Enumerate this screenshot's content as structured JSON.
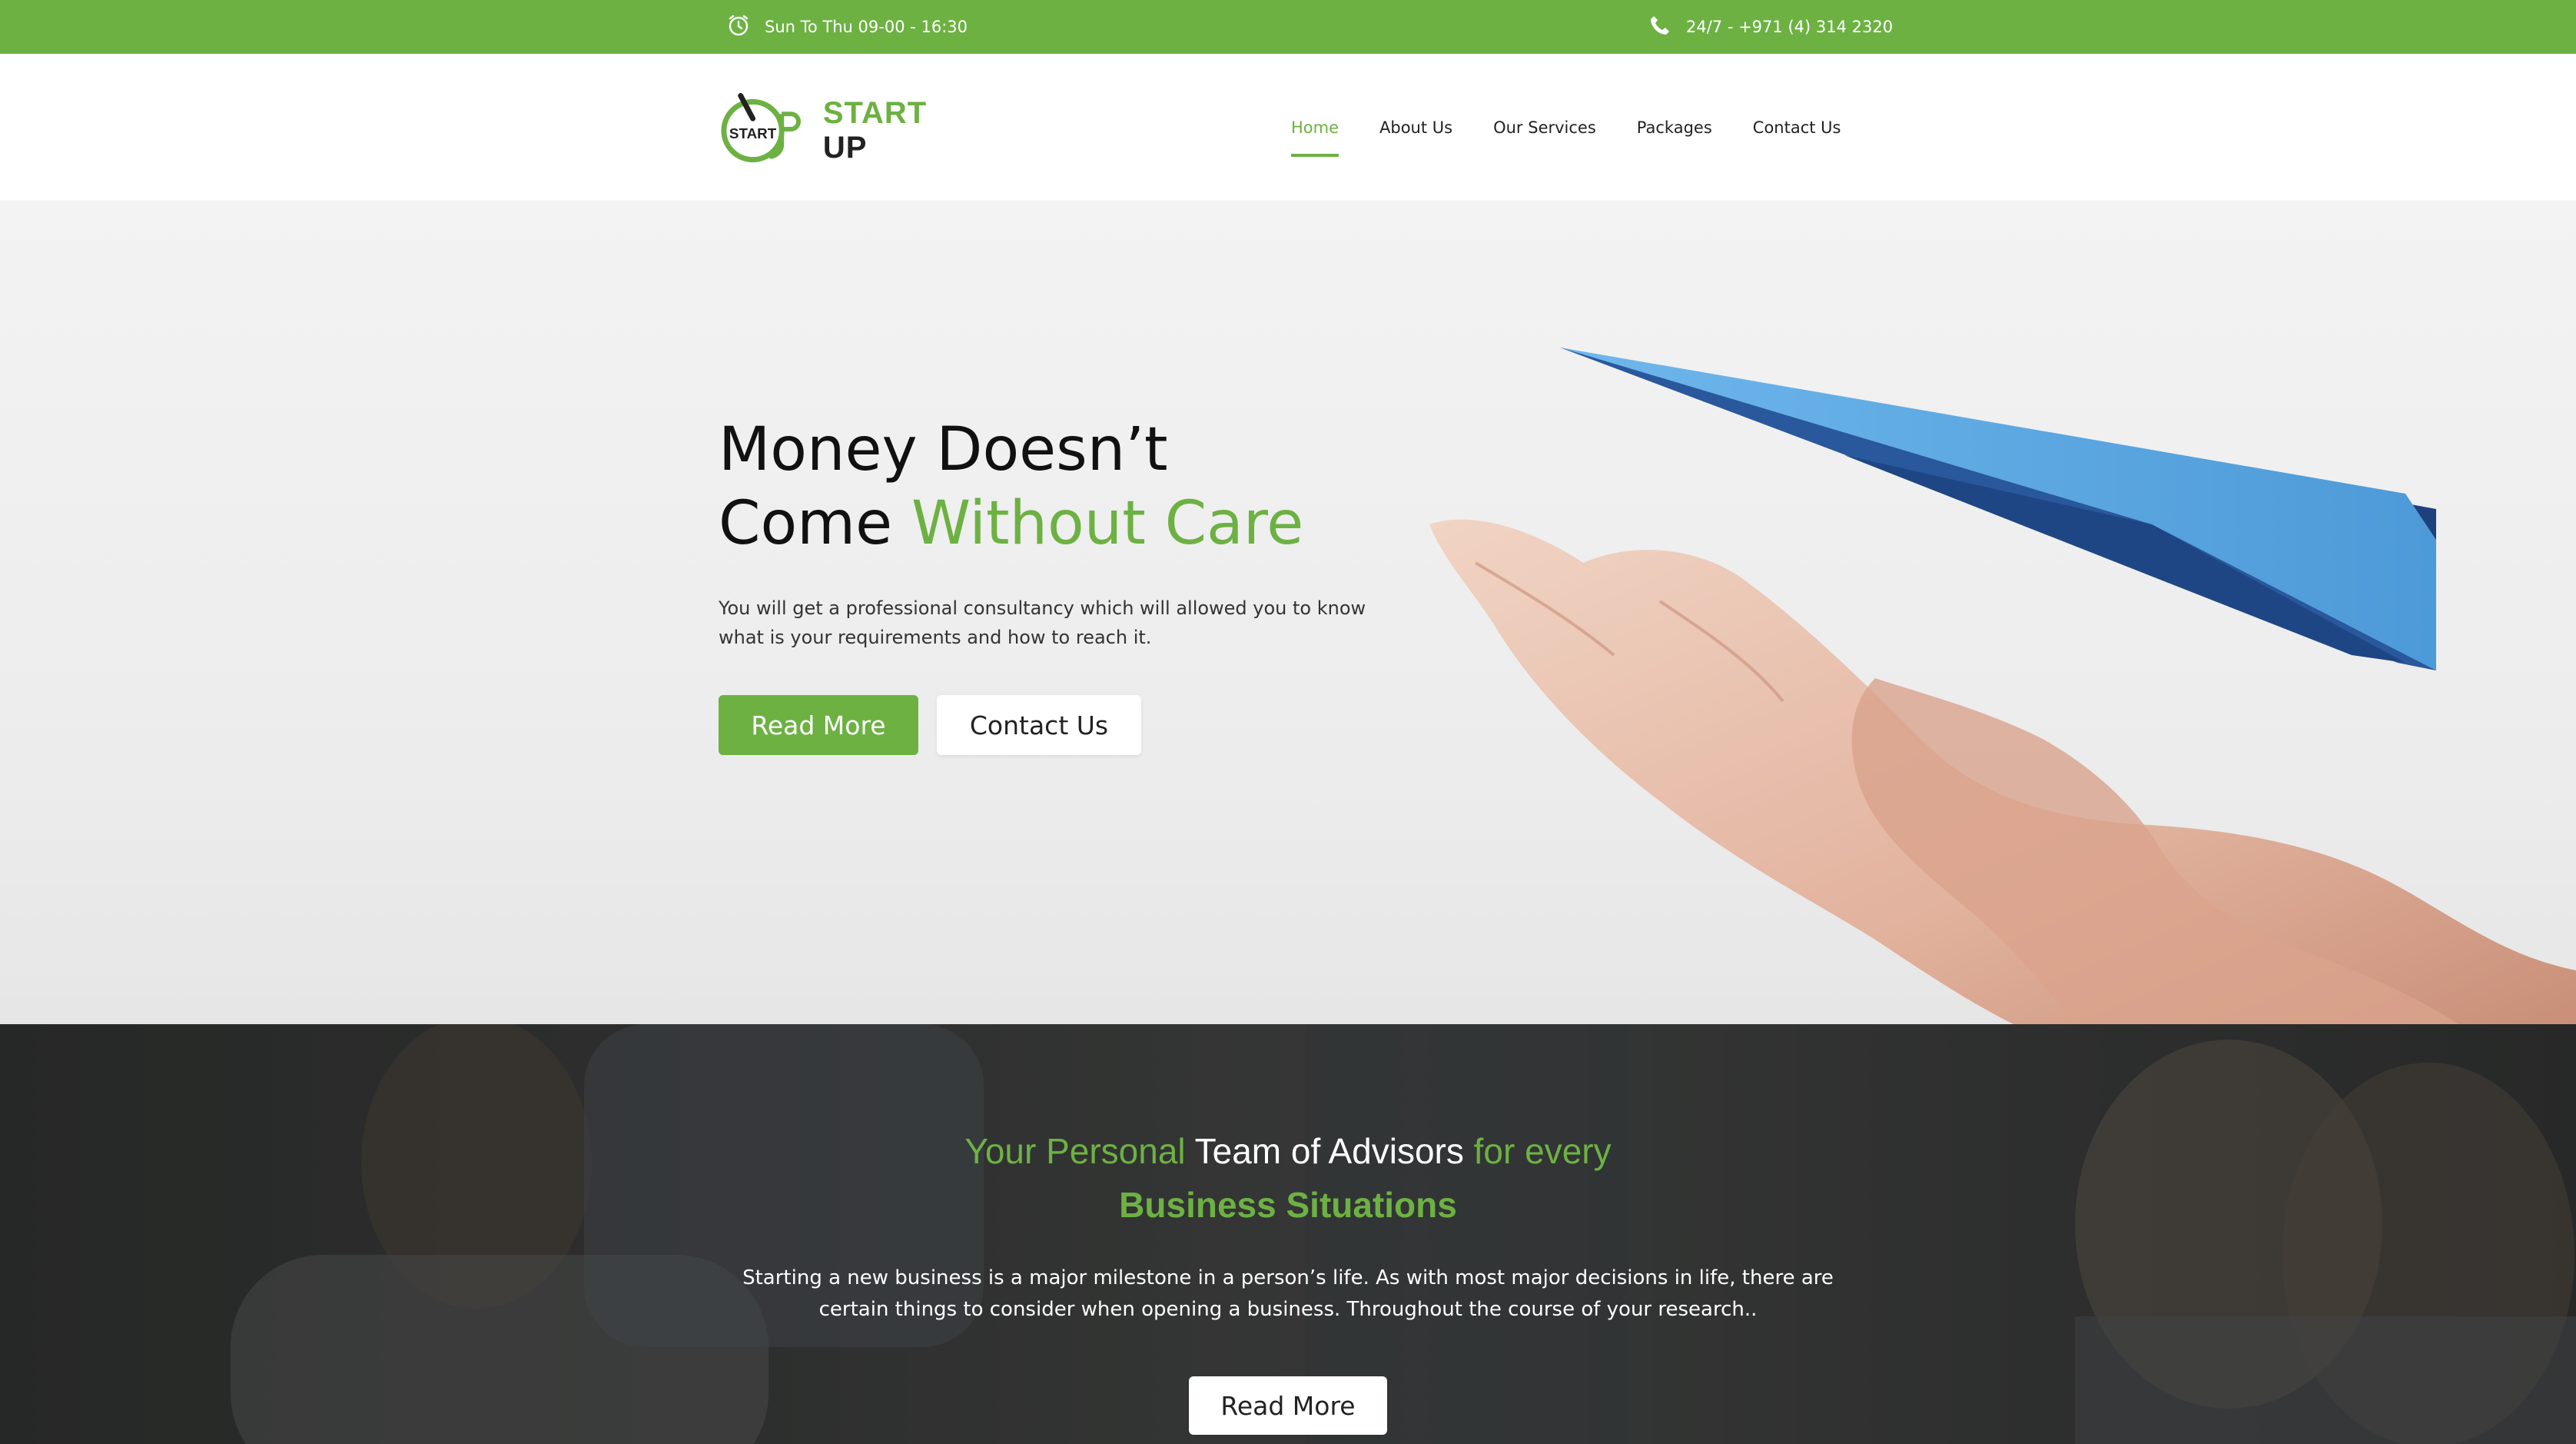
{
  "topbar": {
    "hours": "Sun To Thu 09-00 - 16:30",
    "phone": "24/7 - +971 (4) 314 2320",
    "hours_icon": "alarm-clock-icon",
    "phone_icon": "phone-icon"
  },
  "brand": {
    "logo_mark_text": "START",
    "name_part1": "START",
    "name_part2": "UP"
  },
  "nav": {
    "items": [
      {
        "label": "Home",
        "active": true
      },
      {
        "label": "About Us",
        "active": false
      },
      {
        "label": "Our Services",
        "active": false
      },
      {
        "label": "Packages",
        "active": false
      },
      {
        "label": "Contact Us",
        "active": false
      }
    ]
  },
  "hero": {
    "title_line1": "Money Doesn’t",
    "title_line2_plain": "Come",
    "title_line2_accent": "Without Care",
    "description": "You will get a professional consultancy which will allowed you to know what is your requirements and how to reach it.",
    "primary_button": "Read More",
    "secondary_button": "Contact Us"
  },
  "advisors": {
    "title_green1": "Your Personal",
    "title_white": "Team of Advisors",
    "title_green2": "for every",
    "title_line2": "Business Situations",
    "text": "Starting a new business is a major milestone in a person’s life. As with most major decisions in life, there are certain things to consider when opening a business. Throughout the course of your research..",
    "button": "Read More"
  },
  "colors": {
    "accent": "#6db143",
    "dark_overlay": "#2d302e",
    "paper_plane": "#5aa7e0"
  }
}
